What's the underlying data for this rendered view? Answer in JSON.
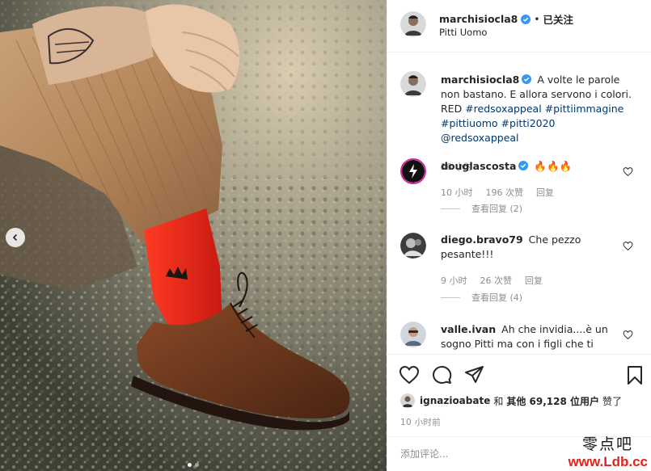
{
  "post": {
    "author": "marchisiocla8",
    "follow_status": "已关注",
    "separator": "•",
    "location": "Pitti Uomo",
    "caption_lead": "A volte le parole non bastano. E allora servono i colori. RED",
    "caption_tags": [
      "#redsoxappeal",
      "#pittiimmagine",
      "#pittiuomo",
      "#pitti2020",
      "@redsoxappeal"
    ],
    "caption_time": "10 小时"
  },
  "comments": [
    {
      "user": "douglascosta",
      "verified": true,
      "text": "🔥🔥🔥",
      "time": "10 小时",
      "likes": "196 次赞",
      "reply": "回复",
      "view_replies": "查看回复 (2)"
    },
    {
      "user": "diego.bravo79",
      "verified": false,
      "text": "Che pezzo pesante!!!",
      "time": "9 小时",
      "likes": "26 次赞",
      "reply": "回复",
      "view_replies": "查看回复 (4)"
    },
    {
      "user": "valle.ivan",
      "verified": false,
      "text": "Ah che invidia....è un sogno Pitti ma con i figli che ti"
    }
  ],
  "likes_line": {
    "user": "ignazioabate",
    "and": "和",
    "others": "其他 69,128 位用户",
    "suffix": "赞了"
  },
  "time_ago": "10 小时前",
  "comment_input": {
    "placeholder": "添加评论..."
  },
  "watermark": {
    "cn": "零点吧",
    "url": "www.Ldb.cc"
  },
  "icons": {
    "like": "heart-icon",
    "comment": "comment-icon",
    "share": "paper-plane-icon",
    "save": "bookmark-icon",
    "verified": "verified-badge-icon",
    "prev": "chevron-left-icon"
  },
  "colors": {
    "verified": "#3897f0",
    "link": "#00376b",
    "muted": "#8e8e8e",
    "sock": "#e8231a"
  },
  "carousel": {
    "slides": 2,
    "active": 0
  }
}
